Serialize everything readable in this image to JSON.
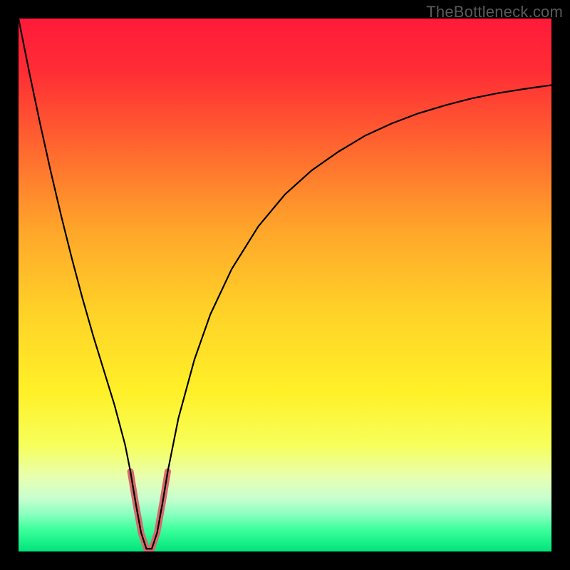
{
  "watermark": "TheBottleneck.com",
  "chart_data": {
    "type": "line",
    "title": "",
    "xlabel": "",
    "ylabel": "",
    "xlim": [
      0,
      100
    ],
    "ylim": [
      0,
      100
    ],
    "grid": false,
    "gradient_stops": [
      {
        "offset": 0.0,
        "color": "#ff1a3a"
      },
      {
        "offset": 0.1,
        "color": "#ff2d35"
      },
      {
        "offset": 0.25,
        "color": "#ff6a2f"
      },
      {
        "offset": 0.4,
        "color": "#ffa72a"
      },
      {
        "offset": 0.55,
        "color": "#ffd228"
      },
      {
        "offset": 0.7,
        "color": "#fff028"
      },
      {
        "offset": 0.8,
        "color": "#f7ff5a"
      },
      {
        "offset": 0.86,
        "color": "#e8ffb0"
      },
      {
        "offset": 0.9,
        "color": "#c8ffd0"
      },
      {
        "offset": 0.93,
        "color": "#8affc0"
      },
      {
        "offset": 0.96,
        "color": "#3aff9a"
      },
      {
        "offset": 1.0,
        "color": "#00e47a"
      }
    ],
    "series": [
      {
        "name": "bottleneck-curve",
        "stroke": "#000000",
        "stroke_width": 2.2,
        "x": [
          0.0,
          2.0,
          4.0,
          6.0,
          8.0,
          10.0,
          12.0,
          14.0,
          16.0,
          18.0,
          20.0,
          21.0,
          22.0,
          23.0,
          24.0,
          25.0,
          26.0,
          27.0,
          28.0,
          30.0,
          33.0,
          36.0,
          40.0,
          45.0,
          50.0,
          55.0,
          60.0,
          65.0,
          70.0,
          75.0,
          80.0,
          85.0,
          90.0,
          95.0,
          100.0
        ],
        "y": [
          100.0,
          90.0,
          80.5,
          71.5,
          63.0,
          55.0,
          47.5,
          40.5,
          34.0,
          27.5,
          20.0,
          15.0,
          9.0,
          3.5,
          0.5,
          0.5,
          3.5,
          9.0,
          15.0,
          25.0,
          36.0,
          44.5,
          53.0,
          61.0,
          67.0,
          71.5,
          75.0,
          78.0,
          80.3,
          82.2,
          83.7,
          85.0,
          86.0,
          86.8,
          87.5
        ]
      }
    ],
    "highlight": {
      "name": "bottom-notch",
      "stroke": "#d66a6a",
      "stroke_width": 9,
      "linecap": "round",
      "x": [
        21.0,
        22.0,
        23.0,
        24.0,
        25.0,
        26.0,
        27.0,
        28.0
      ],
      "y": [
        15.0,
        9.0,
        3.5,
        0.5,
        0.5,
        3.5,
        9.0,
        15.0
      ]
    }
  }
}
